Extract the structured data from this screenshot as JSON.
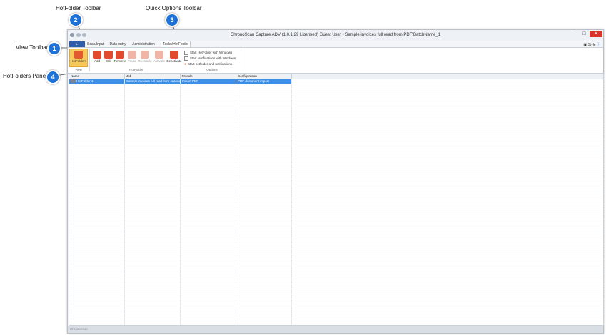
{
  "callouts": [
    {
      "number": "1",
      "label": "View Toolbar"
    },
    {
      "number": "2",
      "label": "HotFolder Toolbar"
    },
    {
      "number": "3",
      "label": "Quick Options Toolbar"
    },
    {
      "number": "4",
      "label": "HotFolders Panel"
    }
  ],
  "window": {
    "title": "ChronoScan Capture ADV (1.0.1.29 Licensed) Guest User  - Sample invoices full read from PDF\\BatchName_1",
    "file_button": "▸",
    "tabs": [
      "Scan/Input",
      "Data entry",
      "Administration",
      "Tasks/HotFolder"
    ],
    "active_tab": "Tasks/HotFolder",
    "style_label": "Style",
    "controls": {
      "minimize": "–",
      "maximize": "□",
      "close": "✕"
    }
  },
  "ribbon": {
    "view_group": {
      "label": "View",
      "buttons": [
        "HotFolders"
      ]
    },
    "hotfolder_group": {
      "label": "HotFolder",
      "buttons": [
        "Add",
        "Edit",
        "Remove",
        "Pause",
        "Reenable",
        "Activate",
        "Deactivate"
      ]
    },
    "options_group": {
      "label": "Options",
      "items": [
        "Start HotFolder with Windows",
        "Start Notifications with Windows",
        "Start hotfolder and notifications"
      ]
    }
  },
  "grid": {
    "columns": [
      "Name",
      "Job",
      "Module",
      "Configuration"
    ],
    "rows": [
      {
        "name": "HotFolder 1",
        "job": "Sample invoices full read from scanner",
        "module": "Import PDF",
        "configuration": "PDF document import"
      }
    ]
  },
  "status_text": "ChronoScan",
  "colors": {
    "accent": "#1e73d8",
    "selection": "#3d8ee6",
    "close": "#d9342b"
  }
}
